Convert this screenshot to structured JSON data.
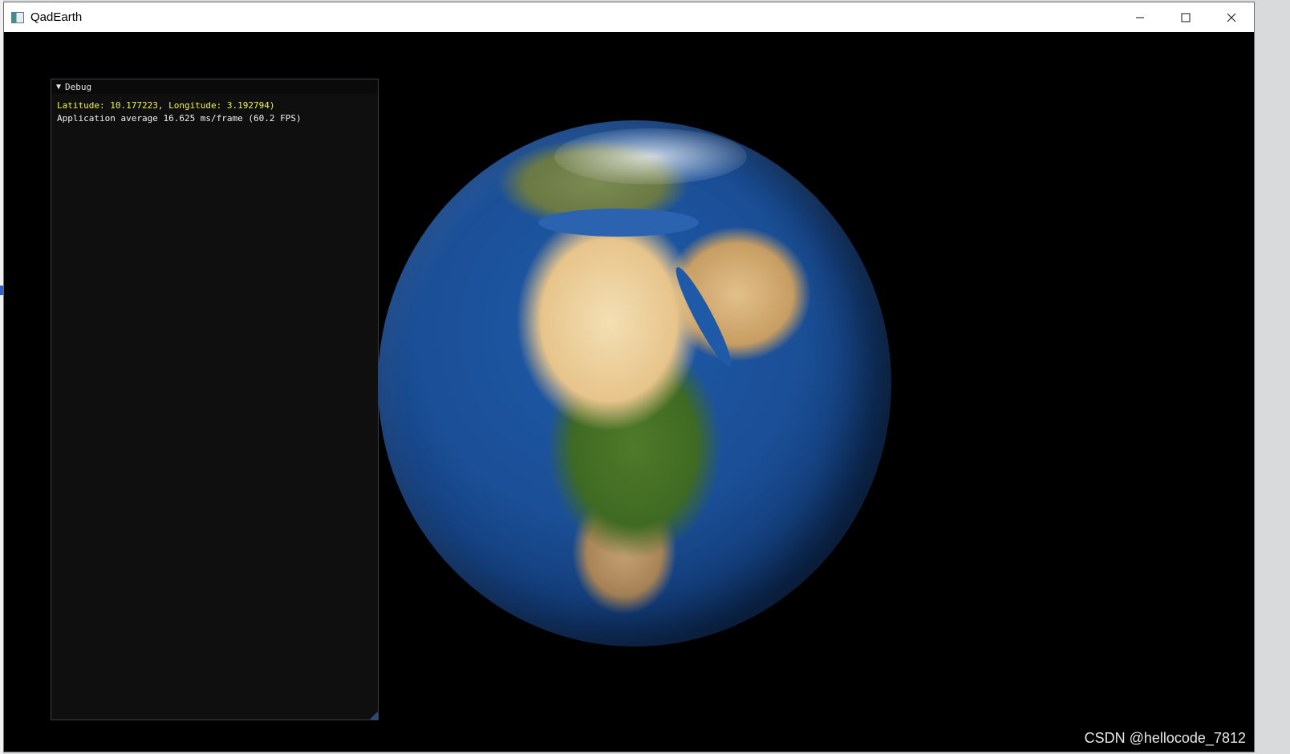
{
  "window": {
    "title": "QadEarth",
    "controls": {
      "minimize_icon": "minimize-icon",
      "maximize_icon": "maximize-icon",
      "close_icon": "close-icon"
    }
  },
  "debug_panel": {
    "title": "Debug",
    "collapse_icon": "collapse-triangle-icon",
    "latlon_text": "Latitude: 10.177223, Longitude: 3.192794)",
    "fps_text": "Application average 16.625 ms/frame (60.2 FPS)",
    "colors": {
      "latlon": "#f4f44a",
      "fps": "#f0f0f0",
      "panel_bg": "#0f0f0f"
    }
  },
  "watermark": "CSDN @hellocode_7812"
}
